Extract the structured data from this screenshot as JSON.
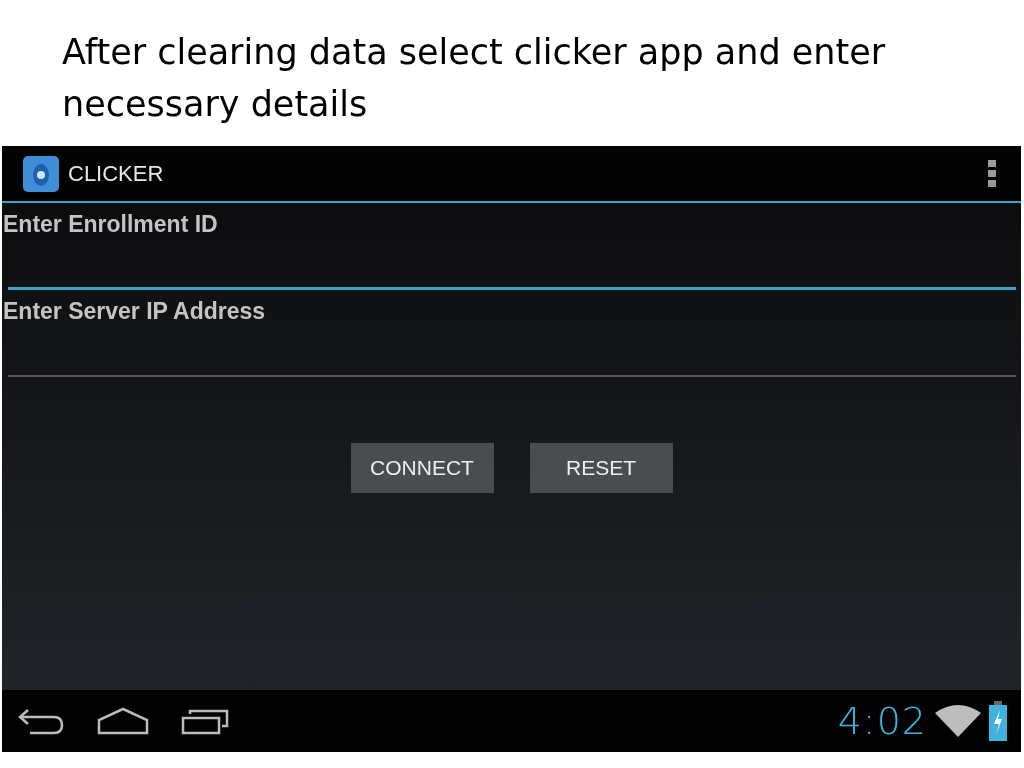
{
  "slide_title": "After clearing data select clicker app and enter necessary details",
  "app_bar": {
    "title": "CLICKER"
  },
  "fields": [
    {
      "label": "Enter Enrollment ID",
      "focused": true
    },
    {
      "label": "Enter Server IP Address",
      "focused": false
    }
  ],
  "buttons": [
    "CONNECT",
    "RESET"
  ],
  "status_bar": {
    "time": "4:02"
  }
}
